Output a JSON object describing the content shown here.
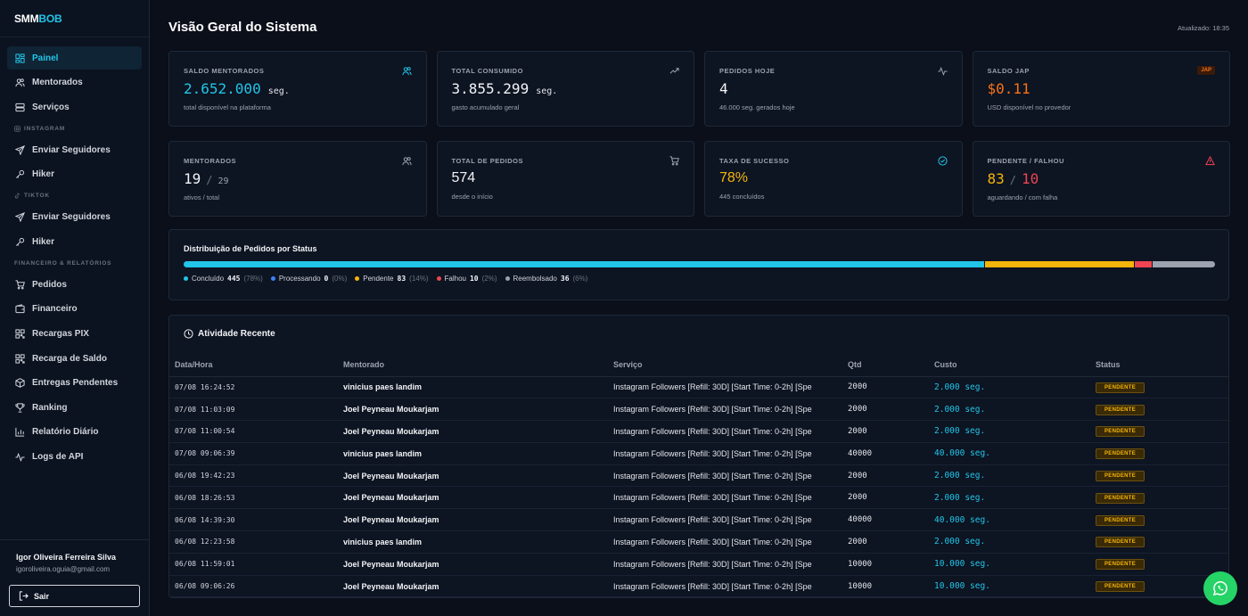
{
  "logo": {
    "part1": "SMM",
    "part2": "BOB"
  },
  "sidebar": {
    "items_main": [
      {
        "label": "Painel",
        "icon": "dashboard-icon"
      },
      {
        "label": "Mentorados",
        "icon": "users-icon"
      },
      {
        "label": "Serviços",
        "icon": "server-icon"
      }
    ],
    "section_instagram": "INSTAGRAM",
    "items_instagram": [
      {
        "label": "Enviar Seguidores",
        "icon": "send-icon"
      },
      {
        "label": "Hiker",
        "icon": "key-icon"
      }
    ],
    "section_tiktok": "TIKTOK",
    "items_tiktok": [
      {
        "label": "Enviar Seguidores",
        "icon": "send-icon"
      },
      {
        "label": "Hiker",
        "icon": "key-icon"
      }
    ],
    "section_fin": "FINANCEIRO & RELATÓRIOS",
    "items_fin": [
      {
        "label": "Pedidos",
        "icon": "cart-icon"
      },
      {
        "label": "Financeiro",
        "icon": "wallet-icon"
      },
      {
        "label": "Recargas PIX",
        "icon": "qr-icon"
      },
      {
        "label": "Recarga de Saldo",
        "icon": "qr-icon"
      },
      {
        "label": "Entregas Pendentes",
        "icon": "package-icon"
      },
      {
        "label": "Ranking",
        "icon": "trophy-icon"
      },
      {
        "label": "Relatório Diário",
        "icon": "bar-chart-icon"
      },
      {
        "label": "Logs de API",
        "icon": "activity-icon"
      }
    ],
    "user_name": "Igor Oliveira Ferreira Silva",
    "user_email": "igoroliveira.oguia@gmail.com",
    "logout_label": "Sair"
  },
  "header": {
    "title": "Visão Geral do Sistema",
    "updated": "Atualizado: 18:35"
  },
  "cards": {
    "c1": {
      "label": "SALDO MENTORADOS",
      "value": "2.652.000",
      "unit": "seg.",
      "desc": "total disponível na plataforma"
    },
    "c2": {
      "label": "TOTAL CONSUMIDO",
      "value": "3.855.299",
      "unit": "seg.",
      "desc": "gasto acumulado geral"
    },
    "c3": {
      "label": "PEDIDOS HOJE",
      "value": "4",
      "desc": "46.000 seg. gerados hoje"
    },
    "c4": {
      "label": "SALDO JAP",
      "badge": "JAP",
      "value": "$0.11",
      "desc": "USD disponível no provedor"
    },
    "c5": {
      "label": "MENTORADOS",
      "value": "19",
      "sep": "/",
      "value2": "29",
      "desc": "ativos / total"
    },
    "c6": {
      "label": "TOTAL DE PEDIDOS",
      "value": "574",
      "desc": "desde o início"
    },
    "c7": {
      "label": "TAXA DE SUCESSO",
      "value": "78%",
      "desc": "445 concluídos"
    },
    "c8": {
      "label": "PENDENTE / FALHOU",
      "value": "83",
      "sep": "/",
      "value2": "10",
      "desc": "aguardando / com falha"
    }
  },
  "distribution": {
    "title": "Distribuição de Pedidos por Status",
    "segments": [
      {
        "name": "Concluído",
        "count": "445",
        "pct": "(78%)",
        "fraction": 0.776,
        "color": "#22c5e8"
      },
      {
        "name": "Processando",
        "count": "0",
        "pct": "(0%)",
        "fraction": 0.0,
        "color": "#3b82f6"
      },
      {
        "name": "Pendente",
        "count": "83",
        "pct": "(14%)",
        "fraction": 0.145,
        "color": "#f5b50a"
      },
      {
        "name": "Falhou",
        "count": "10",
        "pct": "(2%)",
        "fraction": 0.018,
        "color": "#ef4451"
      },
      {
        "name": "Reembolsado",
        "count": "36",
        "pct": "(6%)",
        "fraction": 0.061,
        "color": "#9ca3af"
      }
    ]
  },
  "activity": {
    "title": "Atividade Recente",
    "columns": [
      "Data/Hora",
      "Mentorado",
      "Serviço",
      "Qtd",
      "Custo",
      "Status"
    ],
    "rows": [
      {
        "date": "07/08 16:24:52",
        "user": "vinicius paes landim",
        "service": "Instagram Followers [Refill: 30D] [Start Time: 0-2h] [Spe",
        "qty": "2000",
        "cost": "2.000 seg.",
        "status": "PENDENTE"
      },
      {
        "date": "07/08 11:03:09",
        "user": "Joel Peyneau Moukarjam",
        "service": "Instagram Followers [Refill: 30D] [Start Time: 0-2h] [Spe",
        "qty": "2000",
        "cost": "2.000 seg.",
        "status": "PENDENTE"
      },
      {
        "date": "07/08 11:00:54",
        "user": "Joel Peyneau Moukarjam",
        "service": "Instagram Followers [Refill: 30D] [Start Time: 0-2h] [Spe",
        "qty": "2000",
        "cost": "2.000 seg.",
        "status": "PENDENTE"
      },
      {
        "date": "07/08 09:06:39",
        "user": "vinicius paes landim",
        "service": "Instagram Followers [Refill: 30D] [Start Time: 0-2h] [Spe",
        "qty": "40000",
        "cost": "40.000 seg.",
        "status": "PENDENTE"
      },
      {
        "date": "06/08 19:42:23",
        "user": "Joel Peyneau Moukarjam",
        "service": "Instagram Followers [Refill: 30D] [Start Time: 0-2h] [Spe",
        "qty": "2000",
        "cost": "2.000 seg.",
        "status": "PENDENTE"
      },
      {
        "date": "06/08 18:26:53",
        "user": "Joel Peyneau Moukarjam",
        "service": "Instagram Followers [Refill: 30D] [Start Time: 0-2h] [Spe",
        "qty": "2000",
        "cost": "2.000 seg.",
        "status": "PENDENTE"
      },
      {
        "date": "06/08 14:39:30",
        "user": "Joel Peyneau Moukarjam",
        "service": "Instagram Followers [Refill: 30D] [Start Time: 0-2h] [Spe",
        "qty": "40000",
        "cost": "40.000 seg.",
        "status": "PENDENTE"
      },
      {
        "date": "06/08 12:23:58",
        "user": "vinicius paes landim",
        "service": "Instagram Followers [Refill: 30D] [Start Time: 0-2h] [Spe",
        "qty": "2000",
        "cost": "2.000 seg.",
        "status": "PENDENTE"
      },
      {
        "date": "06/08 11:59:01",
        "user": "Joel Peyneau Moukarjam",
        "service": "Instagram Followers [Refill: 30D] [Start Time: 0-2h] [Spe",
        "qty": "10000",
        "cost": "10.000 seg.",
        "status": "PENDENTE"
      },
      {
        "date": "06/08 09:06:26",
        "user": "Joel Peyneau Moukarjam",
        "service": "Instagram Followers [Refill: 30D] [Start Time: 0-2h] [Spe",
        "qty": "10000",
        "cost": "10.000 seg.",
        "status": "PENDENTE"
      }
    ]
  }
}
